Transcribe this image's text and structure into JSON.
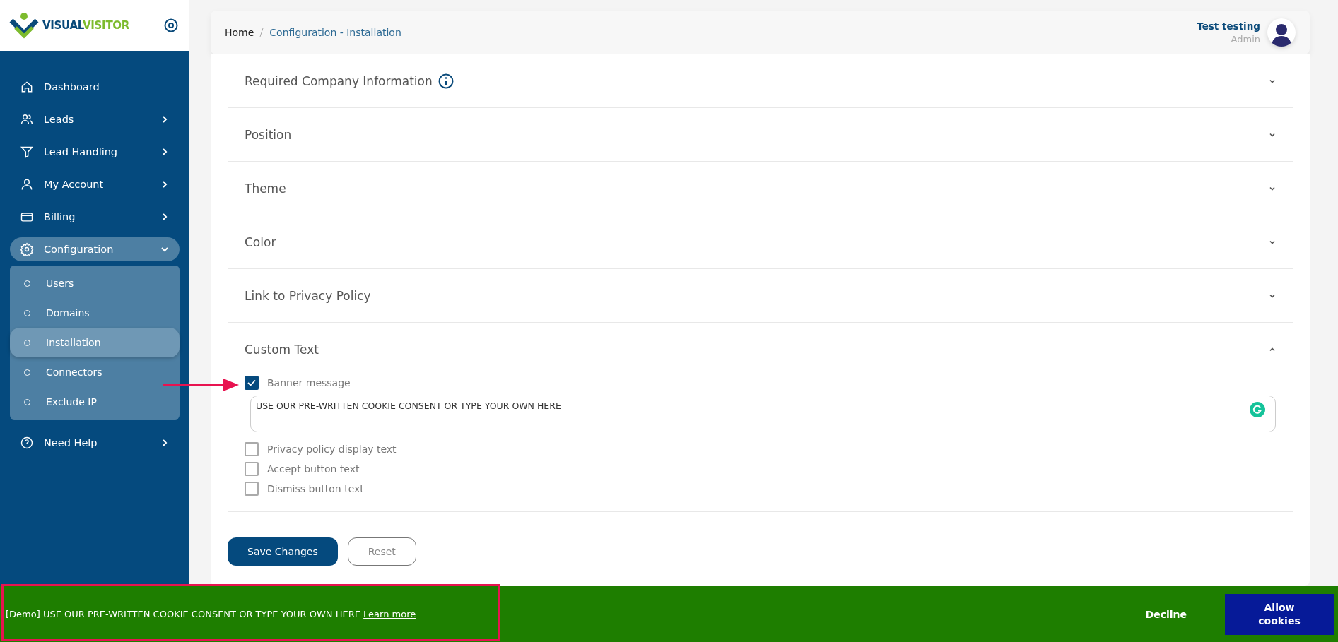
{
  "sidebar": {
    "logo_text": [
      "VISUAL",
      "VISITOR"
    ],
    "items": [
      {
        "label": "Dashboard",
        "has_submenu": false,
        "expanded": false
      },
      {
        "label": "Leads",
        "has_submenu": true,
        "expanded": false
      },
      {
        "label": "Lead Handling",
        "has_submenu": true,
        "expanded": false
      },
      {
        "label": "My Account",
        "has_submenu": true,
        "expanded": false
      },
      {
        "label": "Billing",
        "has_submenu": true,
        "expanded": false
      },
      {
        "label": "Configuration",
        "has_submenu": true,
        "expanded": true,
        "children": [
          {
            "label": "Users",
            "selected": false
          },
          {
            "label": "Domains",
            "selected": false
          },
          {
            "label": "Installation",
            "selected": true
          },
          {
            "label": "Connectors",
            "selected": false
          },
          {
            "label": "Exclude IP",
            "selected": false
          }
        ]
      },
      {
        "label": "Need Help",
        "has_submenu": true,
        "expanded": false
      }
    ]
  },
  "breadcrumb": [
    "Home",
    "Configuration - Installation"
  ],
  "user": {
    "name": "Test testing",
    "role": "Admin"
  },
  "sections": [
    {
      "title": "Required Company Information",
      "info": true,
      "expanded": false
    },
    {
      "title": "Position",
      "info": false,
      "expanded": false
    },
    {
      "title": "Theme",
      "info": false,
      "expanded": false
    },
    {
      "title": "Color",
      "info": false,
      "expanded": false
    },
    {
      "title": "Link to Privacy Policy",
      "info": false,
      "expanded": false
    },
    {
      "title": "Custom Text",
      "info": false,
      "expanded": true
    }
  ],
  "custom_text_options": [
    {
      "label": "Banner message",
      "checked": true,
      "value": "USE OUR PRE-WRITTEN COOKIE CONSENT OR TYPE YOUR OWN HERE"
    },
    {
      "label": "Privacy policy display text",
      "checked": false
    },
    {
      "label": "Accept button text",
      "checked": false
    },
    {
      "label": "Dismiss button text",
      "checked": false
    }
  ],
  "buttons": [
    "Save Changes",
    "Reset"
  ],
  "cookie_banner": {
    "message": "[Demo] USE OUR PRE-WRITTEN COOKIE CONSENT OR TYPE YOUR OWN HERE",
    "link": "Learn more",
    "buttons": [
      "Decline",
      "Allow cookies"
    ]
  }
}
